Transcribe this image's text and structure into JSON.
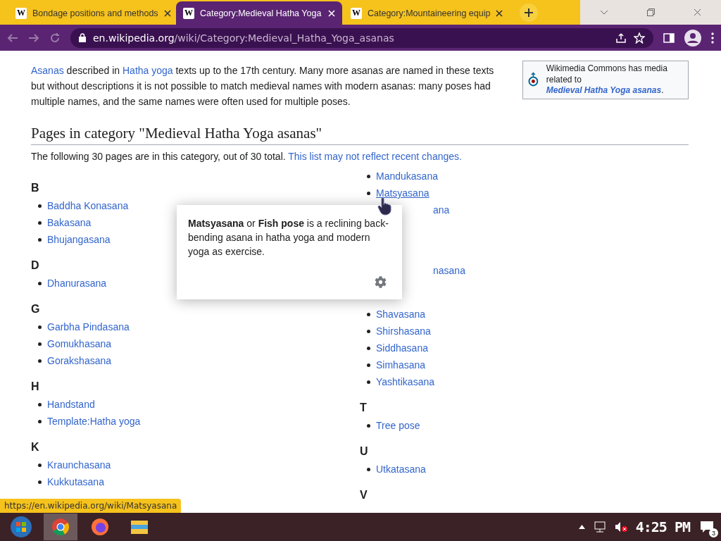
{
  "browser": {
    "tabs": [
      {
        "favicon": "W",
        "title": "Bondage positions and methods",
        "selected": false
      },
      {
        "favicon": "W",
        "title": "Category:Medieval Hatha Yoga",
        "selected": true
      },
      {
        "favicon": "W",
        "title": "Category:Mountaineering equip",
        "selected": false
      }
    ],
    "address": {
      "host": "en.wikipedia.org",
      "path": "/wiki/Category:Medieval_Hatha_Yoga_asanas"
    }
  },
  "intro": [
    {
      "kind": "link",
      "text": "Asanas"
    },
    {
      "kind": "text",
      "text": " described in "
    },
    {
      "kind": "link",
      "text": "Hatha yoga"
    },
    {
      "kind": "text",
      "text": " texts up to the 17th century. Many more asanas are named in these texts but without descriptions it is not possible to match medieval names with modern asanas: many poses had multiple names, and the same names were often used for multiple poses."
    }
  ],
  "commons": {
    "text": "Wikimedia Commons has media related to",
    "link": "Medieval Hatha Yoga asanas",
    "end": "."
  },
  "heading": "Pages in category \"Medieval Hatha Yoga asanas\"",
  "summary": {
    "text": "The following 30 pages are in this category, out of 30 total.",
    "link": "This list may not reflect recent changes."
  },
  "left_sections": [
    {
      "heading": "B",
      "items": [
        {
          "text": "Baddha Konasana",
          "kind": "link"
        },
        {
          "text": "Bakasana",
          "kind": "link"
        },
        {
          "text": "Bhujangasana",
          "kind": "link"
        }
      ]
    },
    {
      "heading": "D",
      "items": [
        {
          "text": "Dhanurasana",
          "kind": "link"
        }
      ]
    },
    {
      "heading": "G",
      "items": [
        {
          "text": "Garbha Pindasana",
          "kind": "link"
        },
        {
          "text": "Gomukhasana",
          "kind": "link"
        },
        {
          "text": "Gorakshasana",
          "kind": "link"
        }
      ]
    },
    {
      "heading": "H",
      "items": [
        {
          "text": "Handstand",
          "kind": "link"
        },
        {
          "text": "Template:Hatha yoga",
          "kind": "link"
        }
      ]
    },
    {
      "heading": "K",
      "items": [
        {
          "text": "Kraunchasana",
          "kind": "link"
        },
        {
          "text": "Kukkutasana",
          "kind": "link"
        }
      ]
    }
  ],
  "right_sections": [
    {
      "items": [
        {
          "text": "Mandukasana",
          "kind": "link",
          "hovered": false
        },
        {
          "text": "Matsyasana",
          "kind": "link",
          "hovered": true
        },
        {
          "text": "ana",
          "kind": "partial"
        }
      ]
    },
    {
      "items": [
        {
          "text": "nasana",
          "kind": "partial"
        }
      ]
    },
    {
      "items": [
        {
          "text": "Shavasana",
          "kind": "link"
        },
        {
          "text": "Shirshasana",
          "kind": "link"
        },
        {
          "text": "Siddhasana",
          "kind": "link"
        },
        {
          "text": "Simhasana",
          "kind": "link"
        },
        {
          "text": "Yashtikasana",
          "kind": "link"
        }
      ]
    },
    {
      "heading": "T",
      "items": [
        {
          "text": "Tree pose",
          "kind": "link"
        }
      ]
    },
    {
      "heading": "U",
      "items": [
        {
          "text": "Utkatasana",
          "kind": "link"
        }
      ]
    },
    {
      "heading": "V"
    }
  ],
  "popup": "**Matsyasana** or **Fish pose** is a reclining back-bending asana in hatha yoga and modern yoga as exercise.",
  "status_url": "https://en.wikipedia.org/wiki/Matsyasana",
  "taskbar": {
    "clock": "4:25 PM",
    "notifications": "3"
  }
}
